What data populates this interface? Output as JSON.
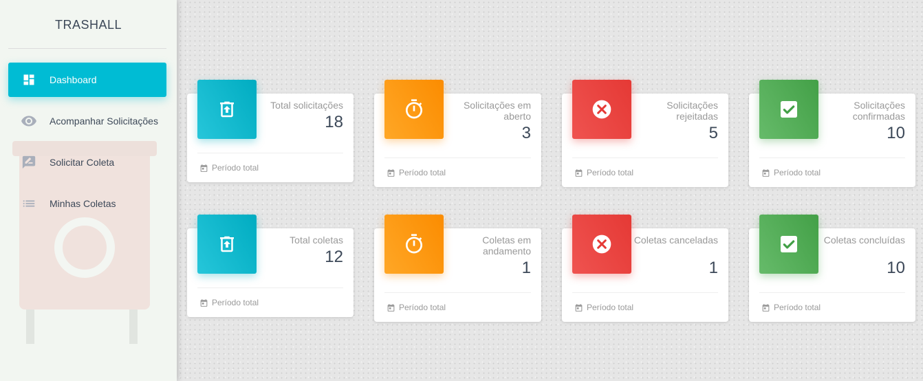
{
  "app": {
    "brand": "TRASHALL"
  },
  "sidebar": {
    "items": [
      {
        "label": "Dashboard",
        "icon": "dashboard-icon",
        "active": true
      },
      {
        "label": "Acompanhar Solicitações",
        "icon": "eye-icon",
        "active": false
      },
      {
        "label": "Solicitar Coleta",
        "icon": "edit-message-icon",
        "active": false
      },
      {
        "label": "Minhas Coletas",
        "icon": "list-icon",
        "active": false
      }
    ]
  },
  "cards": [
    {
      "category": "Total solicitações",
      "value": "18",
      "footer": "Período total",
      "color": "#00acc1",
      "icon": "trash-upload-icon"
    },
    {
      "category": "Solicitações em aberto",
      "value": "3",
      "footer": "Período total",
      "color": "#fb8c00",
      "icon": "timer-icon"
    },
    {
      "category": "Solicitações rejeitadas",
      "value": "5",
      "footer": "Período total",
      "color": "#e53935",
      "icon": "cancel-icon"
    },
    {
      "category": "Solicitações confirmadas",
      "value": "10",
      "footer": "Período total",
      "color": "#43a047",
      "icon": "check-box-icon"
    },
    {
      "category": "Total coletas",
      "value": "12",
      "footer": "Período total",
      "color": "#00acc1",
      "icon": "trash-upload-icon"
    },
    {
      "category": "Coletas em andamento",
      "value": "1",
      "footer": "Período total",
      "color": "#fb8c00",
      "icon": "timer-icon"
    },
    {
      "category": "Coletas canceladas",
      "value": "1",
      "footer": "Período total",
      "color": "#e53935",
      "icon": "cancel-icon"
    },
    {
      "category": "Coletas concluídas",
      "value": "10",
      "footer": "Período total",
      "color": "#43a047",
      "icon": "check-box-icon"
    }
  ]
}
